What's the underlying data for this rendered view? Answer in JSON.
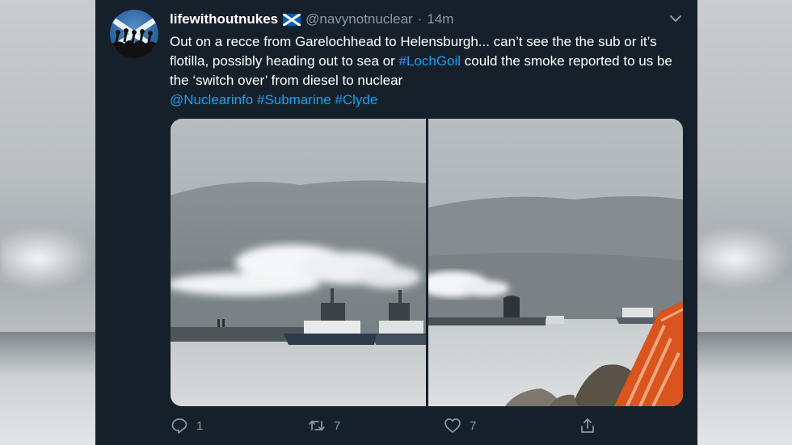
{
  "tweet": {
    "display_name": "lifewithoutnukes",
    "flag_icon": "scotland-flag-icon",
    "handle": "@navynotnuclear",
    "separator": "·",
    "time": "14m",
    "text_plain_1": "Out on a recce from Garelochhead to Helensburgh... can’t see the the sub or it’s flotilla, possibly heading out to sea or ",
    "hashtag_lochgoil": "#LochGoil",
    "text_plain_2": " could the smoke reported to us be the ‘switch over’ from diesel to nuclear",
    "mention_nuclearinfo": "@Nuclearinfo",
    "hashtag_submarine": "#Submarine",
    "hashtag_clyde": "#Clyde"
  },
  "actions": {
    "reply_count": "1",
    "retweet_count": "7",
    "like_count": "7"
  },
  "colors": {
    "background": "#15202b",
    "link": "#1da1f2",
    "muted": "#8899a6"
  }
}
